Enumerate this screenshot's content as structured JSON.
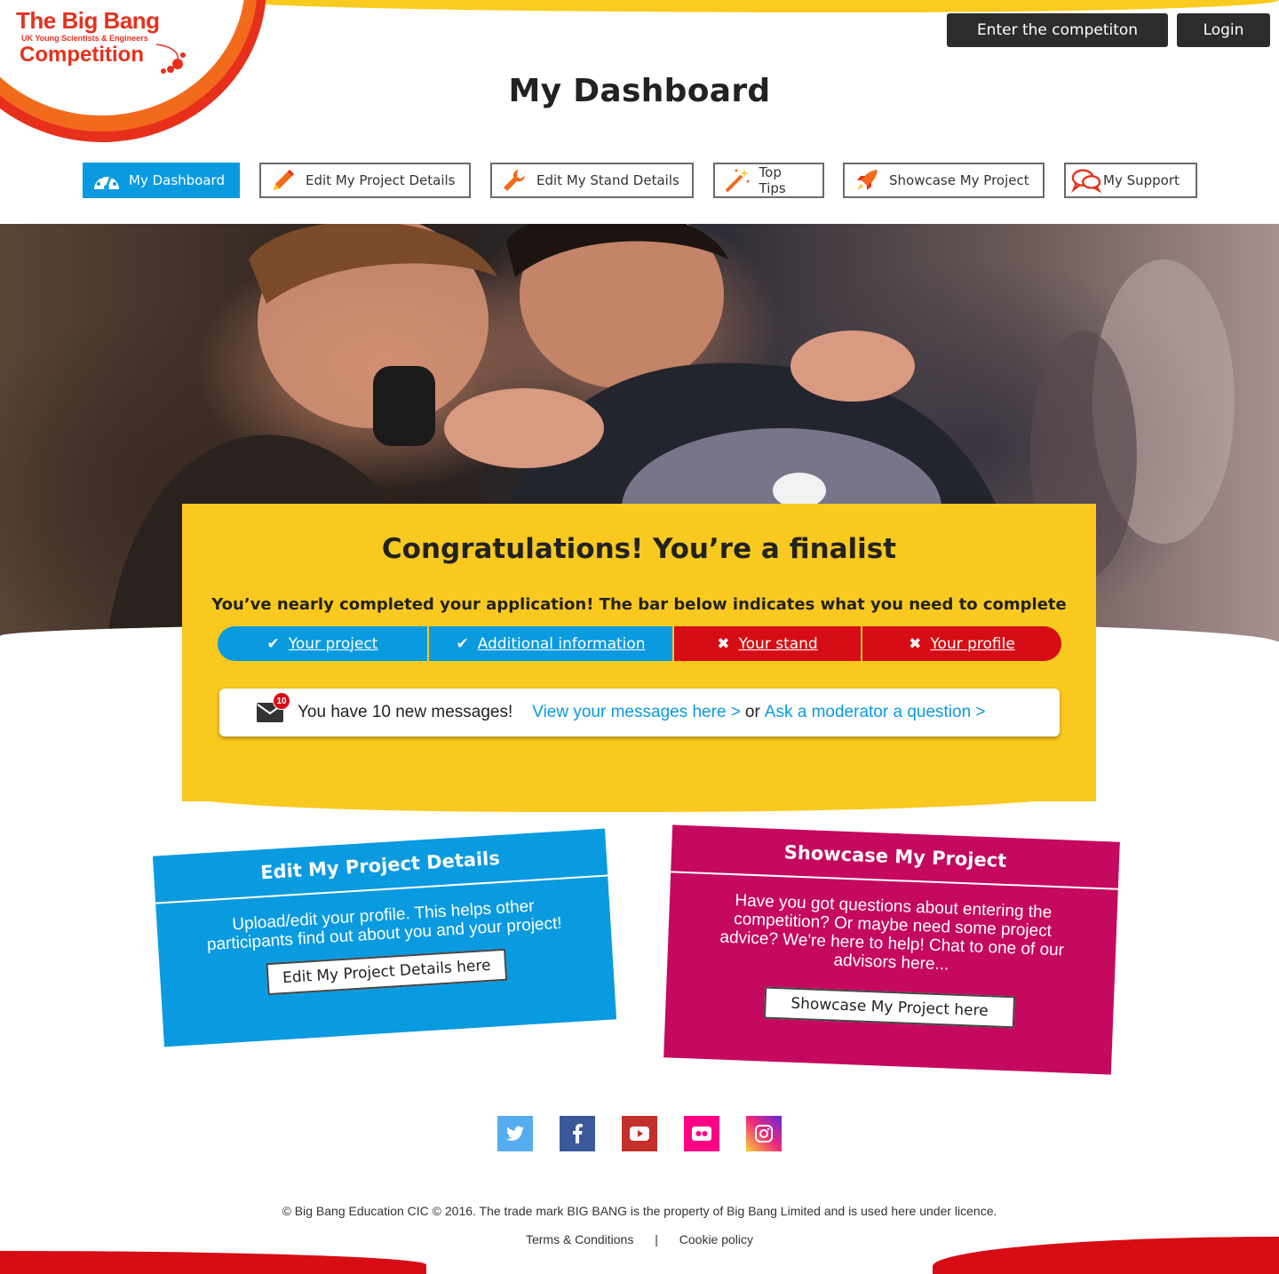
{
  "logo": {
    "line1": "The Big Bang",
    "line2": "UK Young Scientists & Engineers",
    "line3": "Competition"
  },
  "header": {
    "enter_button": "Enter the competiton",
    "login_button": "Login",
    "page_title": "My Dashboard"
  },
  "nav": {
    "items": [
      {
        "label": "My Dashboard",
        "icon": "dashboard-gauge-icon",
        "active": true
      },
      {
        "label": "Edit My Project Details",
        "icon": "pencil-icon",
        "active": false
      },
      {
        "label": "Edit My Stand Details",
        "icon": "wrench-icon",
        "active": false
      },
      {
        "label": "Top Tips",
        "icon": "magic-wand-icon",
        "active": false
      },
      {
        "label": "Showcase My Project",
        "icon": "rocket-icon",
        "active": false
      },
      {
        "label": "My Support",
        "icon": "chat-bubbles-icon",
        "active": false
      }
    ]
  },
  "finalist": {
    "title": "Congratulations! You’re a finalist",
    "subtitle": "You’ve nearly completed your application! The bar below indicates what you need to complete",
    "steps": [
      {
        "label": "Your project",
        "status": "complete",
        "mark": "✔"
      },
      {
        "label": "Additional information",
        "status": "complete",
        "mark": "✔"
      },
      {
        "label": "Your stand",
        "status": "incomplete",
        "mark": "✖"
      },
      {
        "label": "Your profile",
        "status": "incomplete",
        "mark": "✖"
      }
    ],
    "messages": {
      "count": "10",
      "text": "You have 10 new messages!",
      "view_link": "View your messages here >",
      "or": "or",
      "ask_link": "Ask a moderator a question >"
    }
  },
  "cards": {
    "edit": {
      "title": "Edit My Project Details",
      "text": "Upload/edit your profile. This helps other participants find out about you and your project!",
      "button": "Edit My Project Details here"
    },
    "showcase": {
      "title": "Showcase My Project",
      "text": "Have you got questions about entering the competition? Or maybe need some project advice? We're here to help! Chat to one of our advisors here...",
      "button": "Showcase My Project here"
    }
  },
  "social": [
    "twitter-icon",
    "facebook-icon",
    "youtube-icon",
    "flickr-icon",
    "instagram-icon"
  ],
  "footer": {
    "copyright": "© Big Bang Education CIC © 2016. The trade mark BIG BANG is the property of Big Bang Limited and is used here under licence.",
    "terms": "Terms & Conditions",
    "separator": "|",
    "cookie": "Cookie policy"
  },
  "colors": {
    "brand_red": "#e7301c",
    "brand_orange": "#f26b1d",
    "accent_blue": "#0a9ae0",
    "accent_pink": "#c5095f",
    "panel_yellow": "#f9c91f",
    "incomplete_red": "#d60d15"
  }
}
